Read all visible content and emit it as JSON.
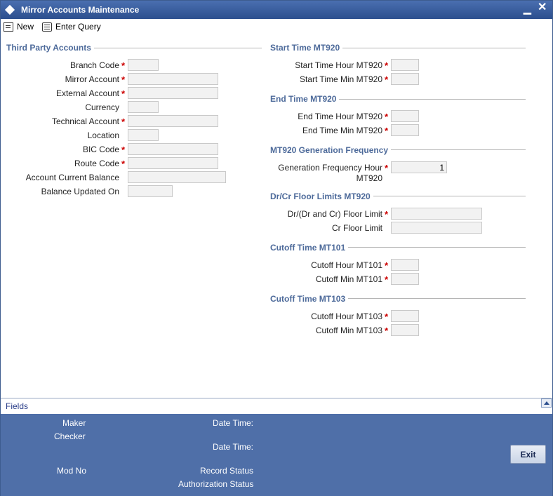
{
  "window": {
    "title": "Mirror Accounts Maintenance",
    "minimize": "▁",
    "close": "✕"
  },
  "toolbar": {
    "new_label": "New",
    "enter_query_label": "Enter Query"
  },
  "third_party": {
    "title": "Third Party Accounts",
    "branch_code": "Branch Code",
    "mirror_account": "Mirror Account",
    "external_account": "External Account",
    "currency": "Currency",
    "technical_account": "Technical Account",
    "location": "Location",
    "bic_code": "BIC Code",
    "route_code": "Route Code",
    "account_current_balance": "Account Current Balance",
    "balance_updated_on": "Balance Updated On"
  },
  "start_time": {
    "title": "Start Time MT920",
    "hour": "Start Time Hour MT920",
    "min": "Start Time Min MT920"
  },
  "end_time": {
    "title": "End Time MT920",
    "hour": "End Time Hour MT920",
    "min": "End Time Min MT920"
  },
  "frequency": {
    "title": "MT920 Generation Frequency",
    "hour_line1": "Generation Frequency Hour",
    "hour_line2": "MT920",
    "hour_value": "1"
  },
  "floor_limits": {
    "title": "Dr/Cr Floor Limits MT920",
    "dr_floor": "Dr/(Dr and Cr) Floor Limit",
    "cr_floor": "Cr Floor Limit"
  },
  "cutoff_101": {
    "title": "Cutoff Time MT101",
    "hour": "Cutoff Hour MT101",
    "min": "Cutoff Min MT101"
  },
  "cutoff_103": {
    "title": "Cutoff Time MT103",
    "hour": "Cutoff Hour MT103",
    "min": "Cutoff Min MT103"
  },
  "required_mark": "*",
  "fields_bar": {
    "label": "Fields"
  },
  "audit": {
    "maker": "Maker",
    "checker": "Checker",
    "date_time_1": "Date Time:",
    "date_time_2": "Date Time:",
    "mod_no": "Mod No",
    "record_status": "Record Status",
    "authorization_status": "Authorization Status",
    "exit_label": "Exit"
  }
}
